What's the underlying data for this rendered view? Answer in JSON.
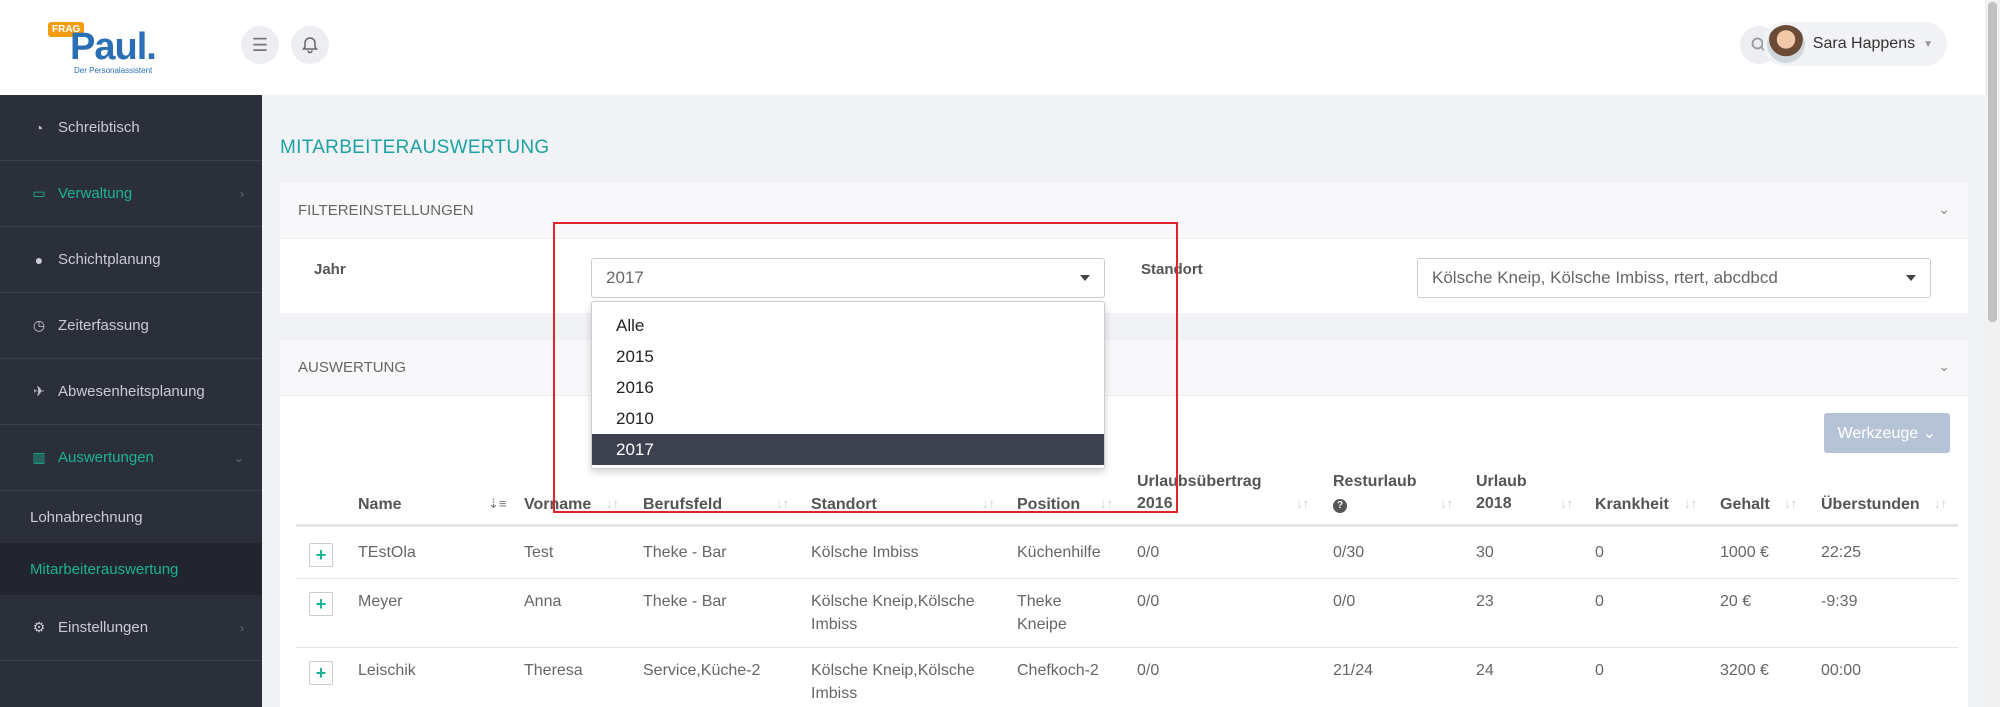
{
  "header": {
    "logo_frag": "FRAG",
    "logo_name": "Paul.",
    "logo_tagline": "Der Personalassistent",
    "user_name": "Sara Happens"
  },
  "sidebar": {
    "items": [
      {
        "label": "Schreibtisch",
        "icon": "dashboard-icon"
      },
      {
        "label": "Verwaltung",
        "icon": "laptop-icon"
      },
      {
        "label": "Schichtplanung",
        "icon": "users-icon"
      },
      {
        "label": "Zeiterfassung",
        "icon": "clock-icon"
      },
      {
        "label": "Abwesenheitsplanung",
        "icon": "plane-icon"
      },
      {
        "label": "Auswertungen",
        "icon": "bar-chart-icon"
      },
      {
        "label": "Lohnabrechnung"
      },
      {
        "label": "Mitarbeiterauswertung"
      },
      {
        "label": "Einstellungen",
        "icon": "gears-icon"
      }
    ]
  },
  "page": {
    "title": "MITARBEITERAUSWERTUNG"
  },
  "filter": {
    "title": "FILTEREINSTELLUNGEN",
    "year_label": "Jahr",
    "year_value": "2017",
    "location_label": "Standort",
    "location_value": "Kölsche Kneip, Kölsche Imbiss, rtert, abcdbcd",
    "year_options": [
      "Alle",
      "2015",
      "2016",
      "2010",
      "2017"
    ]
  },
  "report": {
    "title": "AUSWERTUNG",
    "tools_label": "Werkzeuge",
    "columns": {
      "name": "Name",
      "vorname": "Vorname",
      "berufsfeld": "Berufsfeld",
      "standort": "Standort",
      "position": "Position",
      "urlaub_uebertrag_1": "Urlaubsübertrag",
      "urlaub_uebertrag_2": "2016",
      "resturlaub": "Resturlaub",
      "urlaub_1": "Urlaub",
      "urlaub_2": "2018",
      "krankheit": "Krankheit",
      "gehalt": "Gehalt",
      "ueberstunden": "Überstunden"
    },
    "rows": [
      {
        "name": "TEstOla",
        "vorname": "Test",
        "berufsfeld": "Theke - Bar",
        "standort_1": "Kölsche Imbiss",
        "standort_2": "",
        "position_1": "Küchenhilfe",
        "position_2": "",
        "uebertrag": "0/0",
        "resturlaub": "0/30",
        "urlaub": "30",
        "krankheit": "0",
        "gehalt": "1000 €",
        "ueberstunden": "22:25"
      },
      {
        "name": "Meyer",
        "vorname": "Anna",
        "berufsfeld": "Theke - Bar",
        "standort_1": "Kölsche Kneip,Kölsche",
        "standort_2": "Imbiss",
        "position_1": "Theke",
        "position_2": "Kneipe",
        "uebertrag": "0/0",
        "resturlaub": "0/0",
        "urlaub": "23",
        "krankheit": "0",
        "gehalt": "20 €",
        "ueberstunden": "-9:39"
      },
      {
        "name": "Leischik",
        "vorname": "Theresa",
        "berufsfeld": "Service,Küche-2",
        "standort_1": "Kölsche Kneip,Kölsche",
        "standort_2": "Imbiss",
        "position_1": "Chefkoch-2",
        "position_2": "",
        "uebertrag": "0/0",
        "resturlaub": "21/24",
        "urlaub": "24",
        "krankheit": "0",
        "gehalt": "3200 €",
        "ueberstunden": "00:00"
      }
    ]
  },
  "colors": {
    "accent": "#1ab394",
    "title": "#1aa3a0",
    "sidebar_bg": "#2b2f3a",
    "highlight": "#e0242b"
  }
}
